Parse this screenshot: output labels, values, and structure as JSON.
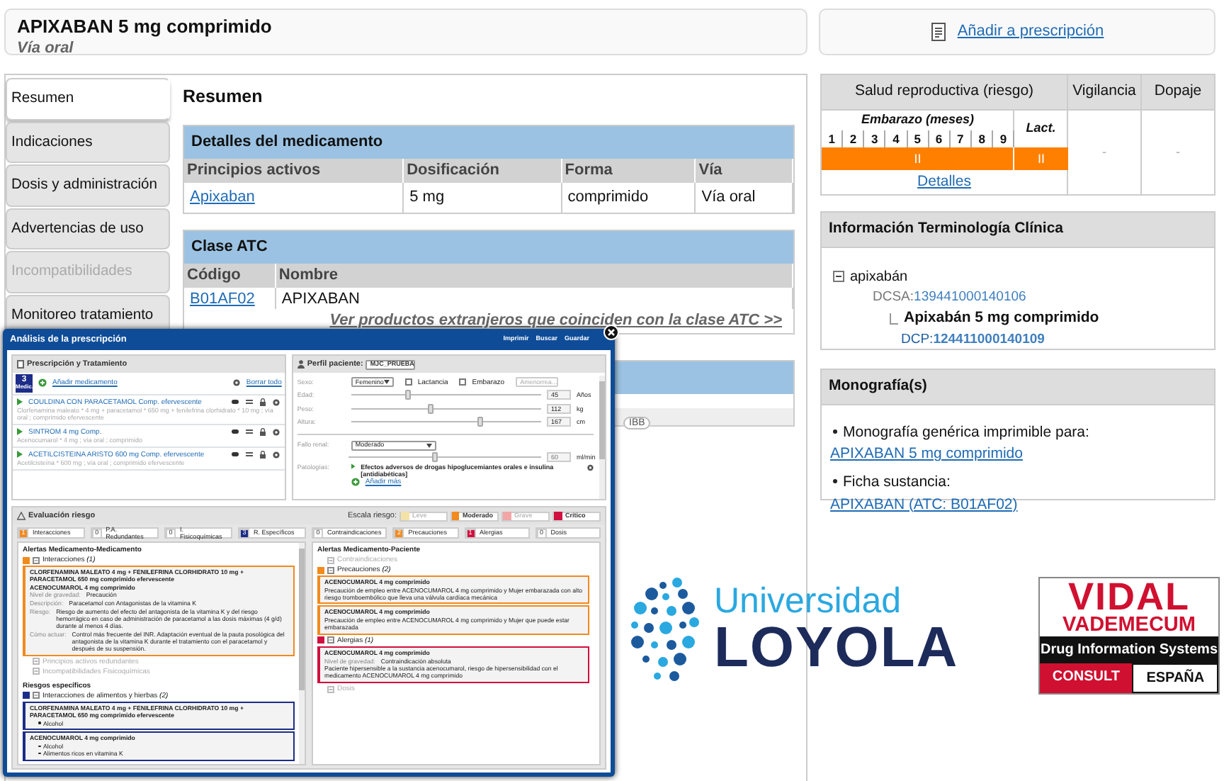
{
  "header": {
    "title": "APIXABAN 5 mg comprimido",
    "subtitle": "Vía oral",
    "action": "Añadir a prescripción"
  },
  "tabs": [
    {
      "label": "Resumen",
      "selected": true,
      "disabled": false
    },
    {
      "label": "Indicaciones",
      "selected": false,
      "disabled": false
    },
    {
      "label": "Dosis y administración",
      "selected": false,
      "disabled": false
    },
    {
      "label": "Advertencias de uso",
      "selected": false,
      "disabled": false
    },
    {
      "label": "Incompatibilidades",
      "selected": false,
      "disabled": true
    },
    {
      "label": "Monitoreo tratamiento",
      "selected": false,
      "disabled": false
    }
  ],
  "summary": {
    "title": "Resumen",
    "details": {
      "title": "Detalles del medicamento",
      "columns": [
        "Principios activos",
        "Dosificación",
        "Forma",
        "Vía"
      ],
      "rows": [
        [
          {
            "text": "Apixaban",
            "link": true
          },
          {
            "text": "5 mg",
            "link": false
          },
          {
            "text": "comprimido",
            "link": false
          },
          {
            "text": "Vía oral",
            "link": false
          }
        ]
      ]
    },
    "atc": {
      "title": "Clase ATC",
      "columns": [
        "Código",
        "Nombre"
      ],
      "rows": [
        [
          {
            "text": "B01AF02",
            "link": true
          },
          {
            "text": "APIXABAN",
            "link": false
          }
        ]
      ],
      "more_link": "Ver productos extranjeros que coinciden con la clase ATC >>"
    },
    "hidden_section": {
      "tag": "IBB"
    }
  },
  "reproductive": {
    "title": "Salud reproductiva (riesgo)",
    "pregnancy_label": "Embarazo (meses)",
    "lactation_label": "Lact.",
    "months": [
      "1",
      "2",
      "3",
      "4",
      "5",
      "6",
      "7",
      "8",
      "9"
    ],
    "pregnancy_risk": {
      "text": "II",
      "color": "#ff8000"
    },
    "lactation_risk": {
      "text": "II",
      "color": "#ff8000"
    },
    "details_link": "Detalles",
    "vigilance": {
      "title": "Vigilancia",
      "value": "-"
    },
    "doping": {
      "title": "Dopaje",
      "value": "-"
    }
  },
  "terminology": {
    "title": "Información Terminología Clínica",
    "tree": [
      {
        "name": "apixabán",
        "expanded": true,
        "code_label": "DCSA:",
        "code": "139441000140106",
        "children": [
          {
            "name": "Apixabán 5 mg comprimido",
            "code_label": "DCP:",
            "code": "124411000140109"
          }
        ]
      }
    ]
  },
  "monographs": {
    "title": "Monografía(s)",
    "items": [
      {
        "label": "Monografía genérica imprimible para:",
        "link": "APIXABAN 5 mg comprimido"
      },
      {
        "label": "Ficha sustancia:",
        "link": "APIXABAN (ATC: B01AF02)"
      }
    ]
  },
  "dialog": {
    "title": "Análisis de la prescripción",
    "actions": [
      "Imprimir",
      "Buscar",
      "Guardar"
    ],
    "prescription": {
      "title": "Prescripción y Tratamiento",
      "count": "3",
      "count_label": "Medic.",
      "add": "Añadir medicamento",
      "clear": "Borrar todo",
      "medications": [
        {
          "name": "COULDINA CON PARACETAMOL Comp. efervescente",
          "detail": "Clorfenamina maleato * 4 mg + paracetamol * 650 mg + fenilefrina clorhidrato * 10 mg ; vía oral ; comprimido efervescente"
        },
        {
          "name": "SINTROM 4 mg Comp.",
          "detail": "Acenocumarol * 4 mg ; vía oral ; comprimido"
        },
        {
          "name": "ACETILCISTEINA ARISTO 600 mg Comp. efervescente",
          "detail": "Acetilcisteína * 600 mg ; vía oral ; comprimido efervescente"
        }
      ]
    },
    "patient": {
      "title": "Perfil paciente:",
      "profile": "MJC_PRUEBA",
      "sex_label": "Sexo:",
      "sex": "Femenino",
      "checks": [
        {
          "label": "Lactancia",
          "checked": false
        },
        {
          "label": "Embarazo",
          "checked": false
        }
      ],
      "amenorrhea_placeholder": "Amenorrea...",
      "measures": [
        {
          "label": "Edad:",
          "level": 0.3,
          "value": "45",
          "unit": "Años"
        },
        {
          "label": "Peso:",
          "level": 0.42,
          "value": "112",
          "unit": "kg"
        },
        {
          "label": "Altura:",
          "level": 0.68,
          "value": "167",
          "unit": "cm"
        }
      ],
      "renal": {
        "label": "Fallo renal:",
        "value": "Moderado",
        "level": 0.45,
        "reading": "60",
        "unit": "ml/min"
      },
      "pathologies": {
        "label": "Patologías:",
        "items": [
          "Efectos adversos de drogas hipoglucemiantes orales e insulina [antidiabéticas]"
        ],
        "add": "Añadir más"
      }
    },
    "evaluation": {
      "title": "Evaluación riesgo",
      "scale_label": "Escala riesgo:",
      "scale": [
        {
          "label": "Leve",
          "color": "#f3e3a8",
          "disabled": true
        },
        {
          "label": "Moderado",
          "color": "#f28a1e",
          "disabled": false
        },
        {
          "label": "Grave",
          "color": "#f2a6a6",
          "disabled": true
        },
        {
          "label": "Crítico",
          "color": "#d01040",
          "disabled": false
        }
      ],
      "drug_counters": [
        {
          "count": "1",
          "label": "Interacciones",
          "color": "#f28a1e"
        },
        {
          "count": "0",
          "label": "P.A. Redundantes",
          "color": "#ffffff"
        },
        {
          "count": "0",
          "label": "I. Fisicoquímicas",
          "color": "#ffffff"
        },
        {
          "count": "3",
          "label": "R. Específicos",
          "color": "#1c2c88"
        }
      ],
      "patient_counters": [
        {
          "count": "0",
          "label": "Contraindicaciones",
          "color": "#ffffff"
        },
        {
          "count": "2",
          "label": "Precauciones",
          "color": "#f28a1e"
        },
        {
          "count": "1",
          "label": "Alergias",
          "color": "#d01040"
        },
        {
          "count": "0",
          "label": "Dosis",
          "color": "#ffffff"
        }
      ]
    },
    "drug_alerts": {
      "title": "Alertas Medicamento-Medicamento",
      "groups": [
        {
          "label": "Interacciones",
          "count": "(1)",
          "color": "#f28a1e",
          "disabled": false,
          "alerts": [
            {
              "title": "CLORFENAMINA MALEATO 4 mg + FENILEFRINA CLORHIDRATO 10 mg + PARACETAMOL 650 mg comprimido efervescente",
              "subtitle": "ACENOCUMAROL 4 mg comprimido",
              "fields": [
                {
                  "label": "Nivel de gravedad:",
                  "value": "Precaución"
                },
                {
                  "label": "Descripción:",
                  "value": "Paracetamol con Antagonistas de la vitamina K"
                },
                {
                  "label": "Riesgo:",
                  "value": "Riesgo de aumento del efecto del antagonista de la vitamina K y del riesgo hemorrágico en caso de administración de paracetamol a las dosis máximas (4 g/d) durante al menos 4 días."
                },
                {
                  "label": "Cómo actuar:",
                  "value": "Control más frecuente del INR. Adaptación eventual de la pauta posológica del antagonista de la vitamina K durante el tratamiento con el paracetamol y después de su suspensión."
                }
              ]
            }
          ]
        },
        {
          "label": "Principios activos redundantes",
          "disabled": true
        },
        {
          "label": "Incompatibilidades Fisicoquímicas",
          "disabled": true
        }
      ],
      "specific_title": "Riesgos específicos",
      "specific_groups": [
        {
          "label": "Interacciones de alimentos y hierbas",
          "count": "(2)",
          "color": "#1c2c88",
          "disabled": false,
          "alerts": [
            {
              "title": "CLORFENAMINA MALEATO 4 mg + FENILEFRINA CLORHIDRATO 10 mg + PARACETAMOL 650 mg comprimido efervescente",
              "items": [
                "Alcohol"
              ]
            },
            {
              "title": "ACENOCUMAROL 4 mg comprimido",
              "items": [
                "Alcohol",
                "Alimentos ricos en vitamina K"
              ]
            }
          ]
        }
      ]
    },
    "patient_alerts": {
      "title": "Alertas Medicamento-Paciente",
      "groups": [
        {
          "label": "Contraindicaciones",
          "disabled": true
        },
        {
          "label": "Precauciones",
          "count": "(2)",
          "color": "#f28a1e",
          "disabled": false,
          "alerts": [
            {
              "title": "ACENOCUMAROL 4 mg comprimido",
              "text": "Precaución de empleo entre ACENOCUMAROL 4 mg comprimido y Mujer embarazada con alto riesgo tromboembólico que lleva una válvula cardíaca mecánica"
            },
            {
              "title": "ACENOCUMAROL 4 mg comprimido",
              "text": "Precaución de empleo entre ACENOCUMAROL 4 mg comprimido y Mujer que puede estar embarazada"
            }
          ]
        },
        {
          "label": "Alergias",
          "count": "(1)",
          "color": "#d01040",
          "disabled": false,
          "alerts": [
            {
              "title": "ACENOCUMAROL 4 mg comprimido",
              "fields": [
                {
                  "label": "Nivel de gravedad:",
                  "value": "Contraindicación absoluta"
                }
              ],
              "text": "Paciente hipersensible a la sustancia acenocumarol, riesgo de hipersensibilidad con el medicamento ACENOCUMAROL 4 mg comprimido"
            }
          ]
        },
        {
          "label": "Dosis",
          "disabled": true
        }
      ]
    }
  },
  "logos": {
    "university": {
      "line1": "Universidad",
      "line2": "LOYOLA"
    },
    "vidal": {
      "brand": "VIDAL",
      "sub": "VADEMECUM",
      "tagline": "Drug Information Systems",
      "badges": [
        "CONSULT",
        "ESPAÑA"
      ]
    }
  }
}
